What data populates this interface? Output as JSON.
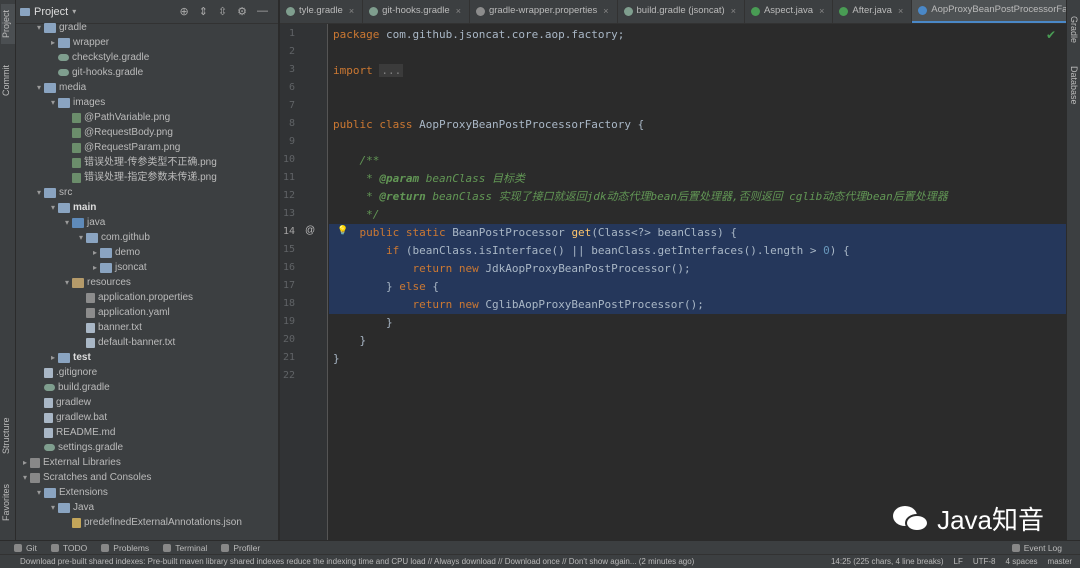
{
  "left_strip": {
    "tabs": [
      "Project",
      "Commit",
      "Structure",
      "Favorites"
    ]
  },
  "right_strip": {
    "tabs": [
      "Gradle",
      "Database"
    ]
  },
  "project_panel": {
    "title": "Project",
    "tree": [
      {
        "depth": 1,
        "arrow": "▾",
        "icon": "folder",
        "label": "gradle",
        "bold": false
      },
      {
        "depth": 2,
        "arrow": "▸",
        "icon": "folder",
        "label": "wrapper",
        "bold": false
      },
      {
        "depth": 2,
        "arrow": "",
        "icon": "gradle",
        "label": "checkstyle.gradle",
        "bold": false
      },
      {
        "depth": 2,
        "arrow": "",
        "icon": "gradle",
        "label": "git-hooks.gradle",
        "bold": false
      },
      {
        "depth": 1,
        "arrow": "▾",
        "icon": "folder",
        "label": "media",
        "bold": false
      },
      {
        "depth": 2,
        "arrow": "▾",
        "icon": "folder",
        "label": "images",
        "bold": false
      },
      {
        "depth": 3,
        "arrow": "",
        "icon": "img",
        "label": "@PathVariable.png",
        "bold": false
      },
      {
        "depth": 3,
        "arrow": "",
        "icon": "img",
        "label": "@RequestBody.png",
        "bold": false
      },
      {
        "depth": 3,
        "arrow": "",
        "icon": "img",
        "label": "@RequestParam.png",
        "bold": false
      },
      {
        "depth": 3,
        "arrow": "",
        "icon": "img",
        "label": "错误处理-传参类型不正确.png",
        "bold": false
      },
      {
        "depth": 3,
        "arrow": "",
        "icon": "img",
        "label": "错误处理-指定参数未传递.png",
        "bold": false
      },
      {
        "depth": 1,
        "arrow": "▾",
        "icon": "folder",
        "label": "src",
        "bold": false
      },
      {
        "depth": 2,
        "arrow": "▾",
        "icon": "folder",
        "label": "main",
        "bold": true
      },
      {
        "depth": 3,
        "arrow": "▾",
        "icon": "folder-src",
        "label": "java",
        "bold": false
      },
      {
        "depth": 4,
        "arrow": "▾",
        "icon": "folder",
        "label": "com.github",
        "bold": false
      },
      {
        "depth": 5,
        "arrow": "▸",
        "icon": "folder",
        "label": "demo",
        "bold": false
      },
      {
        "depth": 5,
        "arrow": "▸",
        "icon": "folder",
        "label": "jsoncat",
        "bold": false
      },
      {
        "depth": 3,
        "arrow": "▾",
        "icon": "folder-res",
        "label": "resources",
        "bold": false
      },
      {
        "depth": 4,
        "arrow": "",
        "icon": "prop",
        "label": "application.properties",
        "bold": false
      },
      {
        "depth": 4,
        "arrow": "",
        "icon": "prop",
        "label": "application.yaml",
        "bold": false
      },
      {
        "depth": 4,
        "arrow": "",
        "icon": "file",
        "label": "banner.txt",
        "bold": false
      },
      {
        "depth": 4,
        "arrow": "",
        "icon": "file",
        "label": "default-banner.txt",
        "bold": false
      },
      {
        "depth": 2,
        "arrow": "▸",
        "icon": "folder",
        "label": "test",
        "bold": true
      },
      {
        "depth": 1,
        "arrow": "",
        "icon": "file",
        "label": ".gitignore",
        "bold": false
      },
      {
        "depth": 1,
        "arrow": "",
        "icon": "gradle",
        "label": "build.gradle",
        "bold": false
      },
      {
        "depth": 1,
        "arrow": "",
        "icon": "file",
        "label": "gradlew",
        "bold": false
      },
      {
        "depth": 1,
        "arrow": "",
        "icon": "file",
        "label": "gradlew.bat",
        "bold": false
      },
      {
        "depth": 1,
        "arrow": "",
        "icon": "file",
        "label": "README.md",
        "bold": false
      },
      {
        "depth": 1,
        "arrow": "",
        "icon": "gradle",
        "label": "settings.gradle",
        "bold": false
      },
      {
        "depth": 0,
        "arrow": "▸",
        "icon": "lib",
        "label": "External Libraries",
        "bold": false
      },
      {
        "depth": 0,
        "arrow": "▾",
        "icon": "lib",
        "label": "Scratches and Consoles",
        "bold": false
      },
      {
        "depth": 1,
        "arrow": "▾",
        "icon": "folder",
        "label": "Extensions",
        "bold": false
      },
      {
        "depth": 2,
        "arrow": "▾",
        "icon": "folder",
        "label": "Java",
        "bold": false
      },
      {
        "depth": 3,
        "arrow": "",
        "icon": "json",
        "label": "predefinedExternalAnnotations.json",
        "bold": false
      }
    ]
  },
  "tabs": [
    {
      "label": "tyle.gradle",
      "color": "#7f9e8e",
      "active": false
    },
    {
      "label": "git-hooks.gradle",
      "color": "#7f9e8e",
      "active": false
    },
    {
      "label": "gradle-wrapper.properties",
      "color": "#8c8c8c",
      "active": false
    },
    {
      "label": "build.gradle (jsoncat)",
      "color": "#7f9e8e",
      "active": false
    },
    {
      "label": "Aspect.java",
      "color": "#499c54",
      "active": false
    },
    {
      "label": "After.java",
      "color": "#499c54",
      "active": false
    },
    {
      "label": "AopProxyBeanPostProcessorFactory.java",
      "color": "#4a88c7",
      "active": true
    }
  ],
  "editor": {
    "current_line": 14,
    "selection": [
      14,
      18
    ],
    "lines": [
      {
        "n": 1,
        "html": "<span class=\"kw\">package</span> com.github.jsoncat.core.aop.factory;"
      },
      {
        "n": 2,
        "html": ""
      },
      {
        "n": 3,
        "html": "<span class=\"kw\">import</span> <span class=\"fold\">...</span>"
      },
      {
        "n": 6,
        "html": ""
      },
      {
        "n": 7,
        "html": ""
      },
      {
        "n": 8,
        "html": "<span class=\"kw\">public class</span> AopProxyBeanPostProcessorFactory {"
      },
      {
        "n": 9,
        "html": ""
      },
      {
        "n": 10,
        "html": "    <span class=\"cm\">/**</span>"
      },
      {
        "n": 11,
        "html": "     <span class=\"cm\">* </span><span class=\"cmtag\">@param</span> <span class=\"cm\">beanClass 目标类</span>"
      },
      {
        "n": 12,
        "html": "     <span class=\"cm\">* </span><span class=\"cmtag\">@return</span> <span class=\"cm\">beanClass 实现了接口就返回jdk动态代理bean后置处理器,否则返回 cglib动态代理bean后置处理器</span>"
      },
      {
        "n": 13,
        "html": "     <span class=\"cm\">*/</span>"
      },
      {
        "n": 14,
        "html": "    <span class=\"kw\">public static</span> BeanPostProcessor <span class=\"fn\">get</span>(Class&lt;?&gt; beanClass) {"
      },
      {
        "n": 15,
        "html": "        <span class=\"kw\">if</span> (beanClass.isInterface() || beanClass.getInterfaces().length &gt; <span class=\"num\">0</span>) {"
      },
      {
        "n": 16,
        "html": "            <span class=\"kw\">return new</span> JdkAopProxyBeanPostProcessor();"
      },
      {
        "n": 17,
        "html": "        } <span class=\"kw\">else</span> {"
      },
      {
        "n": 18,
        "html": "            <span class=\"kw\">return new</span> CglibAopProxyBeanPostProcessor();"
      },
      {
        "n": 19,
        "html": "        }"
      },
      {
        "n": 20,
        "html": "    }"
      },
      {
        "n": 21,
        "html": "}"
      },
      {
        "n": 22,
        "html": ""
      }
    ]
  },
  "bottom_tools": {
    "git": "Git",
    "todo": "TODO",
    "problems": "Problems",
    "terminal": "Terminal",
    "profiler": "Profiler",
    "event_log": "Event Log"
  },
  "status": {
    "message": "Download pre-built shared indexes: Pre-built maven library shared indexes reduce the indexing time and CPU load // Always download // Download once // Don't show again... (2 minutes ago)",
    "position": "14:25 (225 chars, 4 line breaks)",
    "line_sep": "LF",
    "encoding": "UTF-8",
    "indent": "4 spaces",
    "branch": "master"
  },
  "watermark": {
    "text": "Java知音"
  },
  "colors": {
    "accent": "#4a88c7",
    "selection": "#214283",
    "keyword": "#cc7832",
    "comment": "#629755"
  }
}
